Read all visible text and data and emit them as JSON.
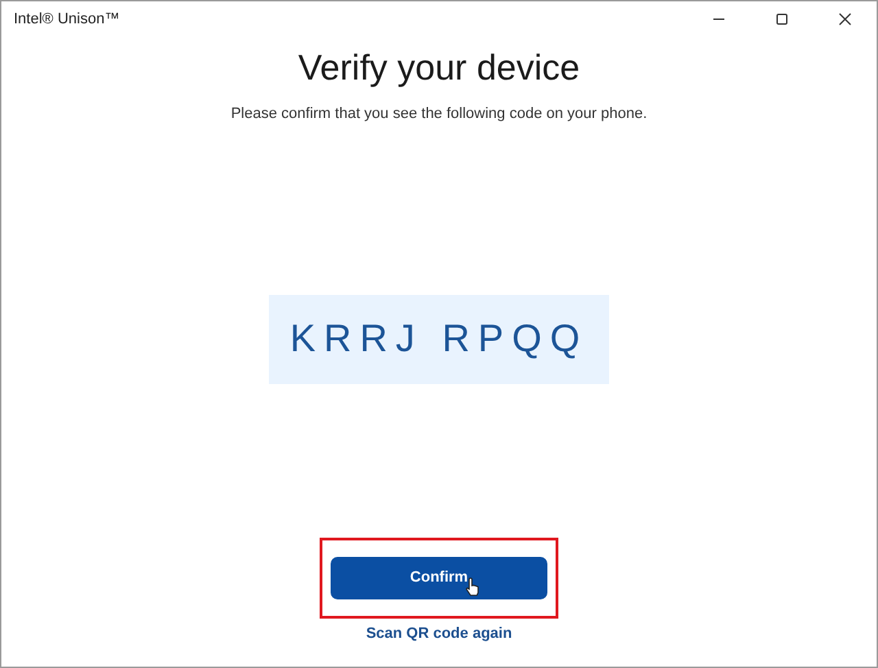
{
  "window": {
    "title": "Intel® Unison™"
  },
  "heading": "Verify your device",
  "instruction": "Please confirm that you see the following code on your phone.",
  "code": "KRRJ RPQQ",
  "confirm_button": {
    "label": "Confirm",
    "highlighted": true
  },
  "link": "Scan QR code again"
}
